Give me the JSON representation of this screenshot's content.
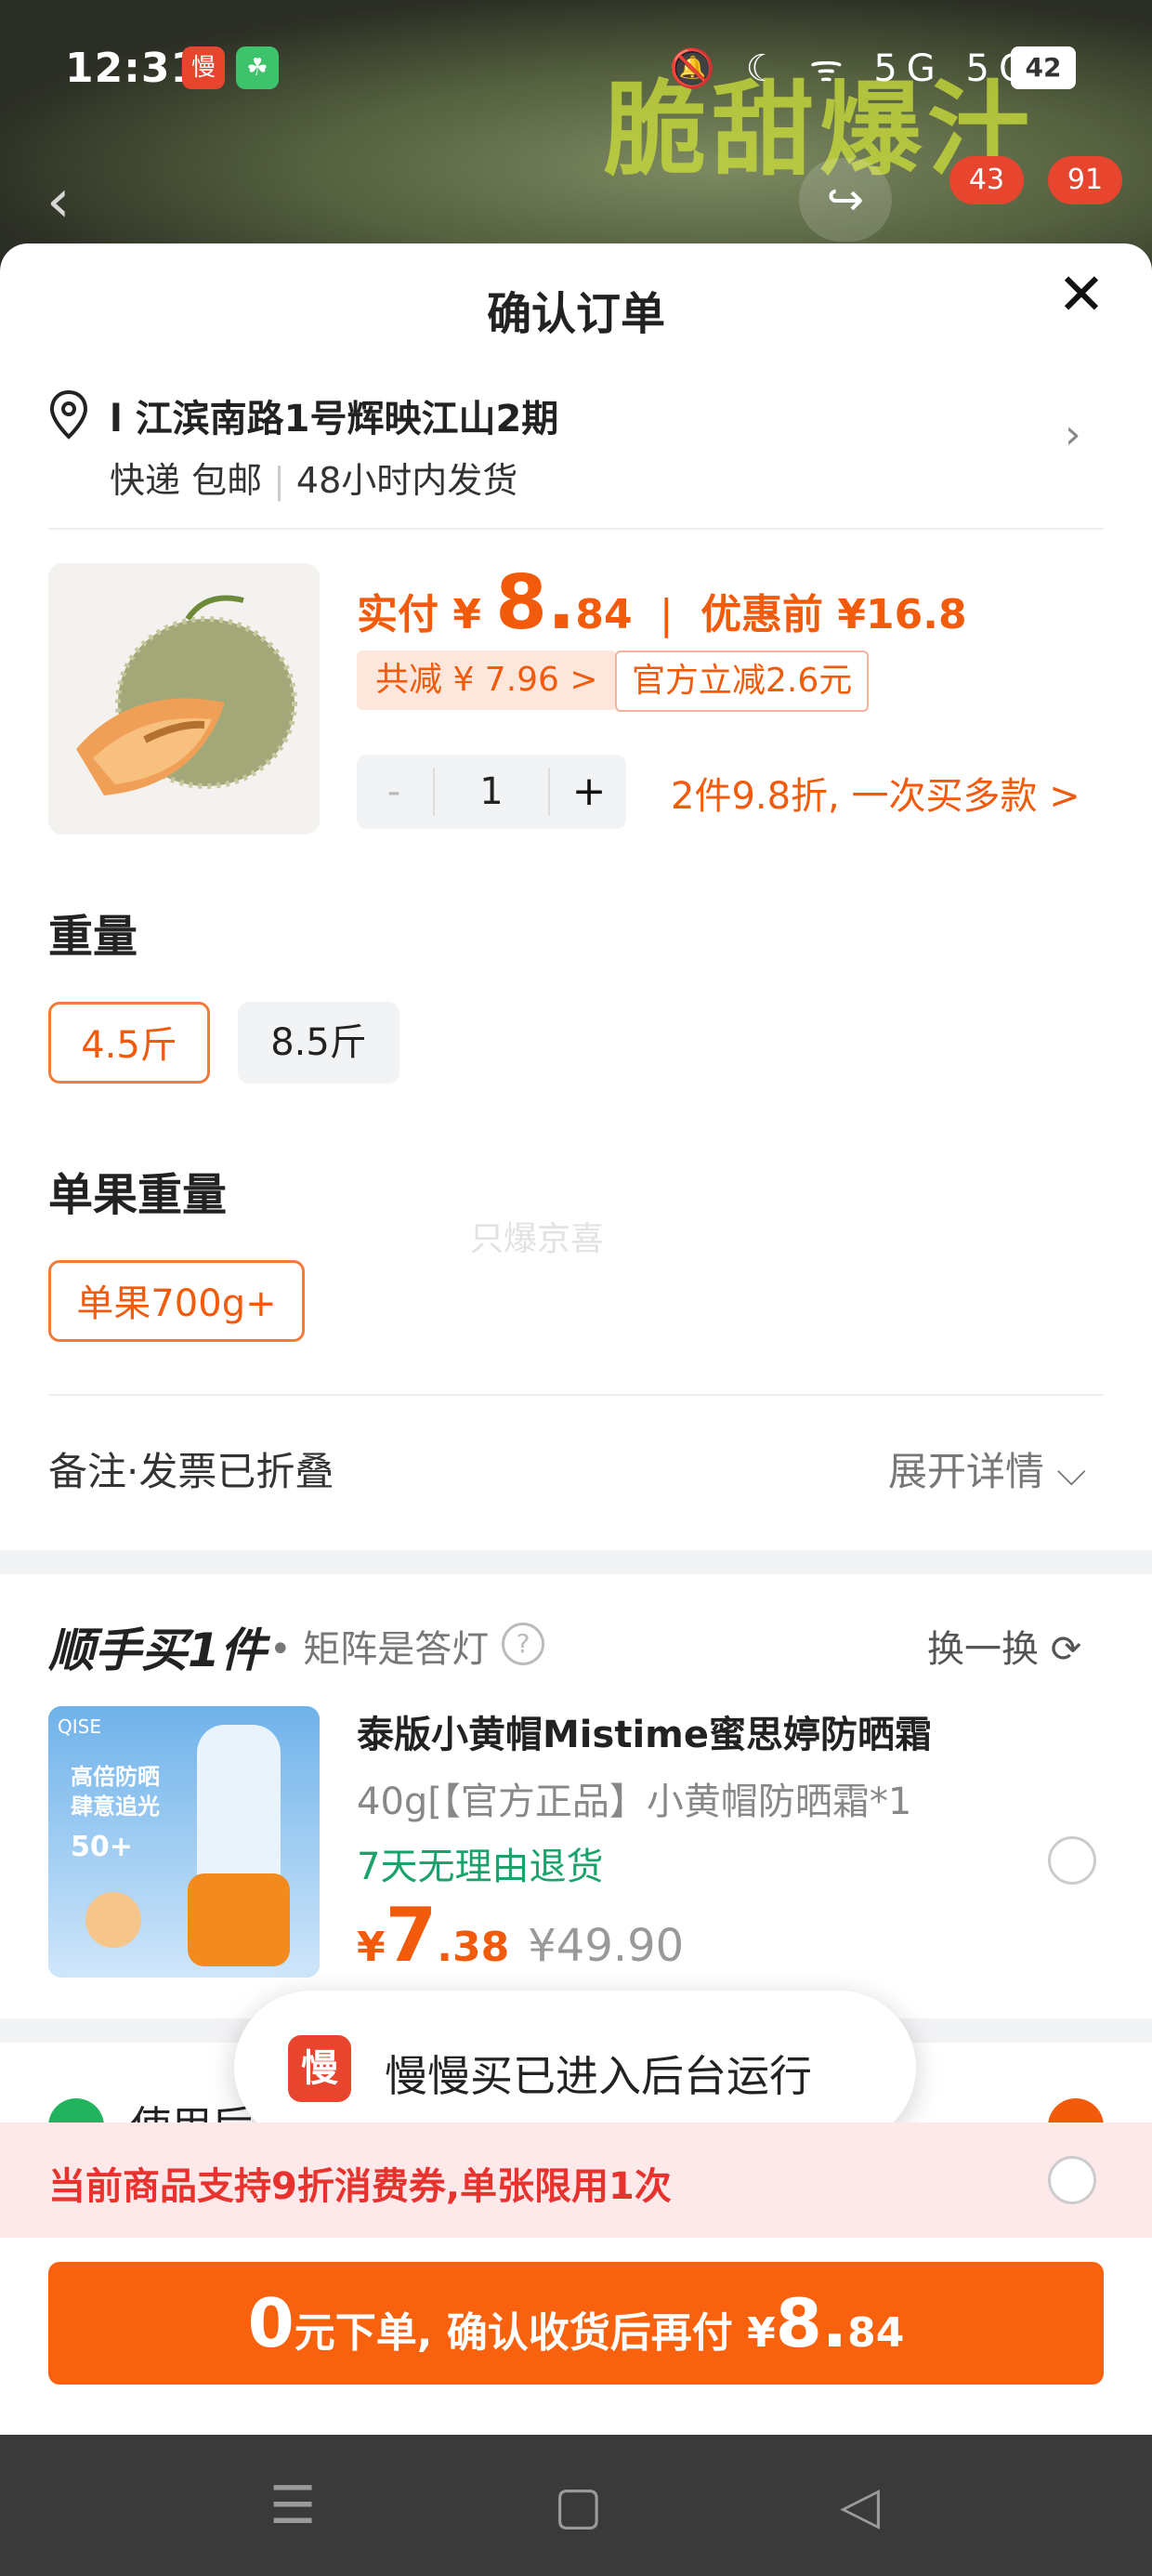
{
  "status_bar": {
    "time": "12:31",
    "app_icon_1": "慢",
    "app_icon_2": "☘",
    "indicators": "🔕 ☾ ᯤ 5G 5G",
    "battery": "42"
  },
  "banner": {
    "title": "脆甜爆汁",
    "cart_count": "43",
    "message_count": "91"
  },
  "sheet": {
    "title": "确认订单",
    "address": "l 江滨南路1号辉映江山2期",
    "delivery": "快递 包邮",
    "ship_time": "48小时内发货"
  },
  "product": {
    "paid_label": "实付",
    "currency": "¥",
    "price_int": "8.",
    "price_dec": "84",
    "pre_label": "优惠前",
    "pre_price": "¥16.8",
    "total_discount": "共减 ¥ 7.96 >",
    "official_discount": "官方立减2.6元",
    "qty_minus": "-",
    "qty": "1",
    "qty_plus": "+",
    "promo": "2件9.8折, 一次买多款 >"
  },
  "weight": {
    "title": "重量",
    "options": [
      "4.5斤",
      "8.5斤"
    ],
    "selected": "4.5斤"
  },
  "single_weight": {
    "title": "单果重量",
    "options": [
      "单果700g+"
    ],
    "selected": "单果700g+"
  },
  "watermark": "只爆京喜",
  "notes": {
    "label": "备注·发票已折叠",
    "expand": "展开详情 ⌵"
  },
  "addon": {
    "logo": "顺手买1件",
    "subtitle": "• 矩阵是答灯",
    "help": "?",
    "swap": "换一换 ⟳",
    "title": "泰版小黄帽Mistime蜜思婷防晒霜",
    "spec": "40g[【官方正品】小黄帽防晒霜*1",
    "return_policy": "7天无理由退货",
    "currency": "¥",
    "price_int": "7",
    "price_dec": ".38",
    "orig_price": "¥49.90",
    "img_brand": "QISE",
    "img_line1": "高倍防晒",
    "img_line2": "肆意追光",
    "img_spf": "50+"
  },
  "hidden_row": {
    "text": "使用后"
  },
  "toast": {
    "icon": "慢",
    "text": "慢慢买已进入后台运行"
  },
  "coupon": {
    "text": "当前商品支持9折消费券,单张限用1次"
  },
  "cta": {
    "zero": "0",
    "text1": "元下单, 确认收货后再付 ¥",
    "amount_int": "8.",
    "amount_dec": "84"
  },
  "nav": {
    "menu": "☰",
    "home": "▢",
    "back": "◁"
  },
  "colors": {
    "accent": "#f25a0c",
    "cta": "#f8620f",
    "coupon_bg": "#fde8ea",
    "green": "#1aa26b"
  }
}
